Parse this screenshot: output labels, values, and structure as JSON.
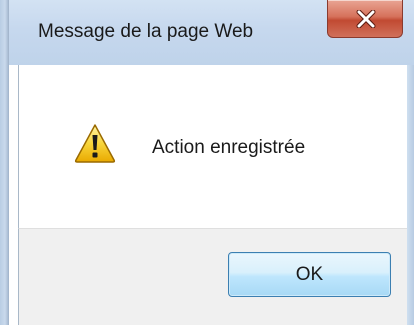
{
  "dialog": {
    "title": "Message de la page Web",
    "message": "Action enregistrée",
    "ok_label": "OK"
  },
  "icons": {
    "close": "close-icon",
    "warning": "warning-icon"
  },
  "colors": {
    "title_bar": "#c6d8ee",
    "close_button": "#c14a32",
    "footer": "#f0f0f0",
    "ok_border": "#3c7fb1"
  }
}
